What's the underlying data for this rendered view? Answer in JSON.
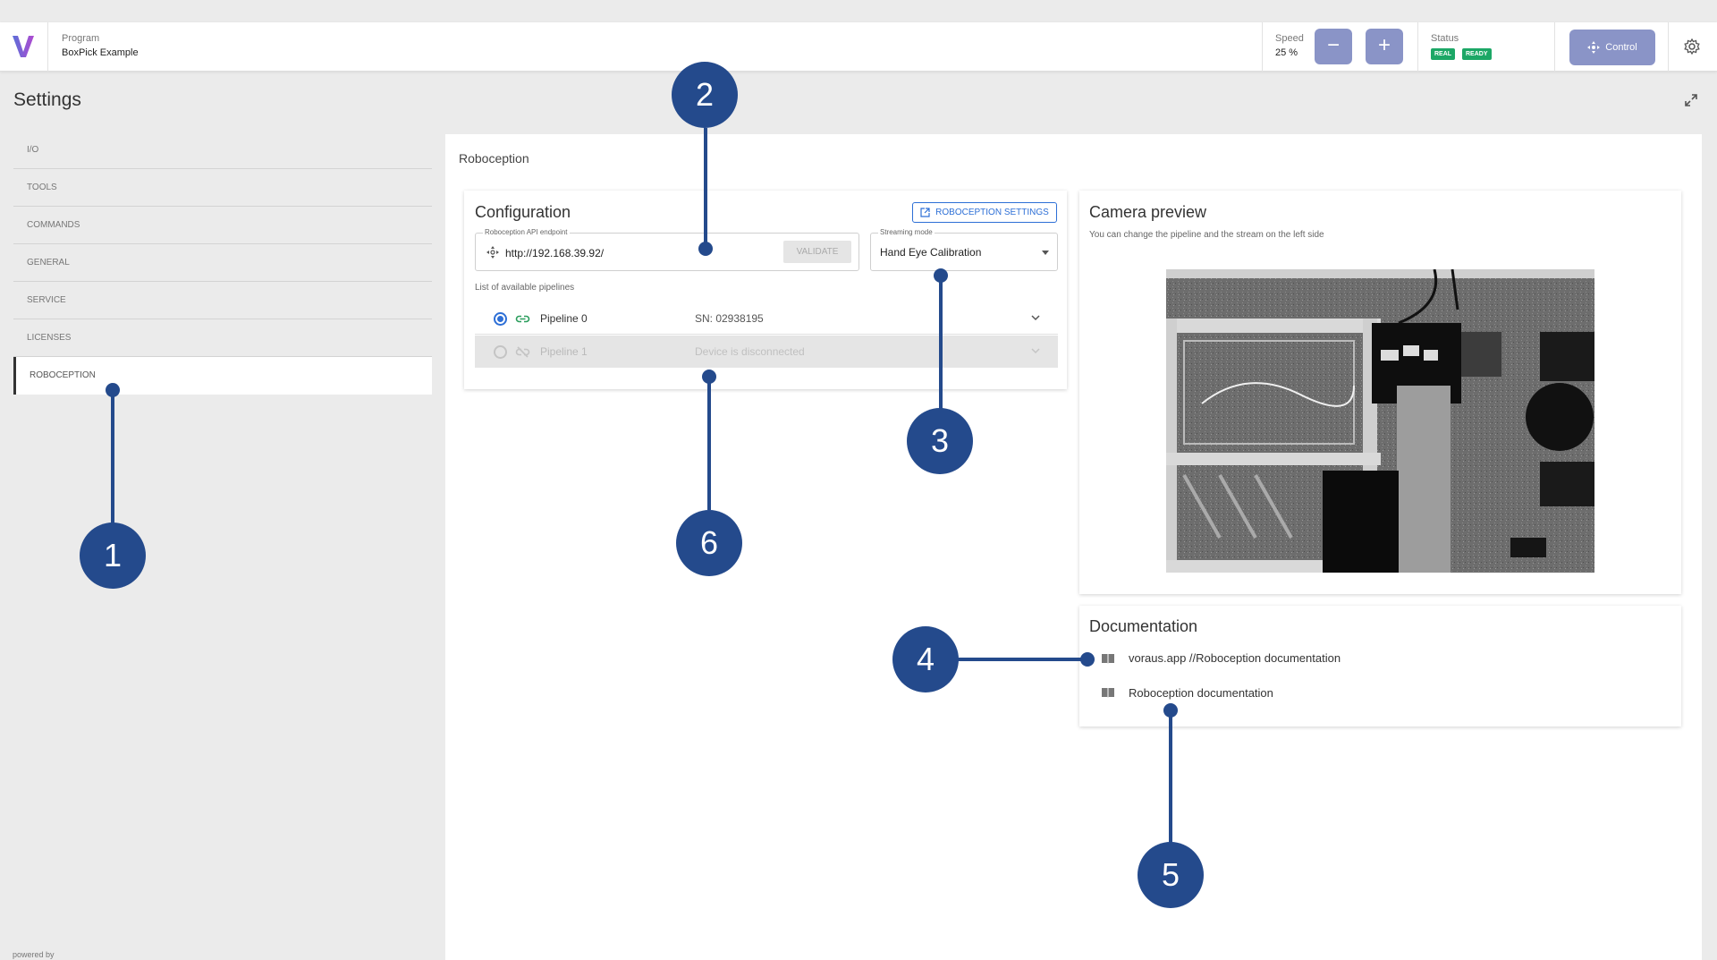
{
  "header": {
    "program_label": "Program",
    "program_value": "BoxPick Example",
    "speed_label": "Speed",
    "speed_value": "25 %",
    "speed_minus": "−",
    "speed_plus": "+",
    "status_label": "Status",
    "status_badges": [
      "REAL",
      "READY"
    ],
    "control_label": "Control"
  },
  "sidebar": {
    "title": "Settings",
    "items": [
      {
        "label": "I/O"
      },
      {
        "label": "TOOLS"
      },
      {
        "label": "COMMANDS"
      },
      {
        "label": "GENERAL"
      },
      {
        "label": "SERVICE"
      },
      {
        "label": "LICENSES"
      },
      {
        "label": "ROBOCEPTION"
      }
    ],
    "active": "ROBOCEPTION",
    "powered_by": "powered by"
  },
  "main": {
    "title": "Roboception",
    "configuration": {
      "title": "Configuration",
      "settings_button": "ROBOCEPTION SETTINGS",
      "endpoint_label": "Roboception API endpoint",
      "endpoint_value": "http://192.168.39.92/",
      "validate_label": "VALIDATE",
      "streaming_label": "Streaming mode",
      "streaming_value": "Hand Eye Calibration",
      "pipelines_label": "List of available pipelines",
      "pipelines": [
        {
          "name": "Pipeline 0",
          "info": "SN: 02938195",
          "selected": true,
          "connected": true
        },
        {
          "name": "Pipeline 1",
          "info": "Device is disconnected",
          "selected": false,
          "connected": false
        }
      ]
    },
    "camera_preview": {
      "title": "Camera preview",
      "subtitle": "You can change the pipeline and the stream on the left side"
    },
    "documentation": {
      "title": "Documentation",
      "links": [
        {
          "label": "voraus.app //Roboception documentation"
        },
        {
          "label": "Roboception documentation"
        }
      ]
    }
  },
  "annotations": [
    "1",
    "2",
    "3",
    "4",
    "5",
    "6"
  ],
  "colors": {
    "accent": "#2d6fd6",
    "callout": "#244a8c",
    "button": "#8a94c7",
    "status_green": "#1ca766"
  }
}
